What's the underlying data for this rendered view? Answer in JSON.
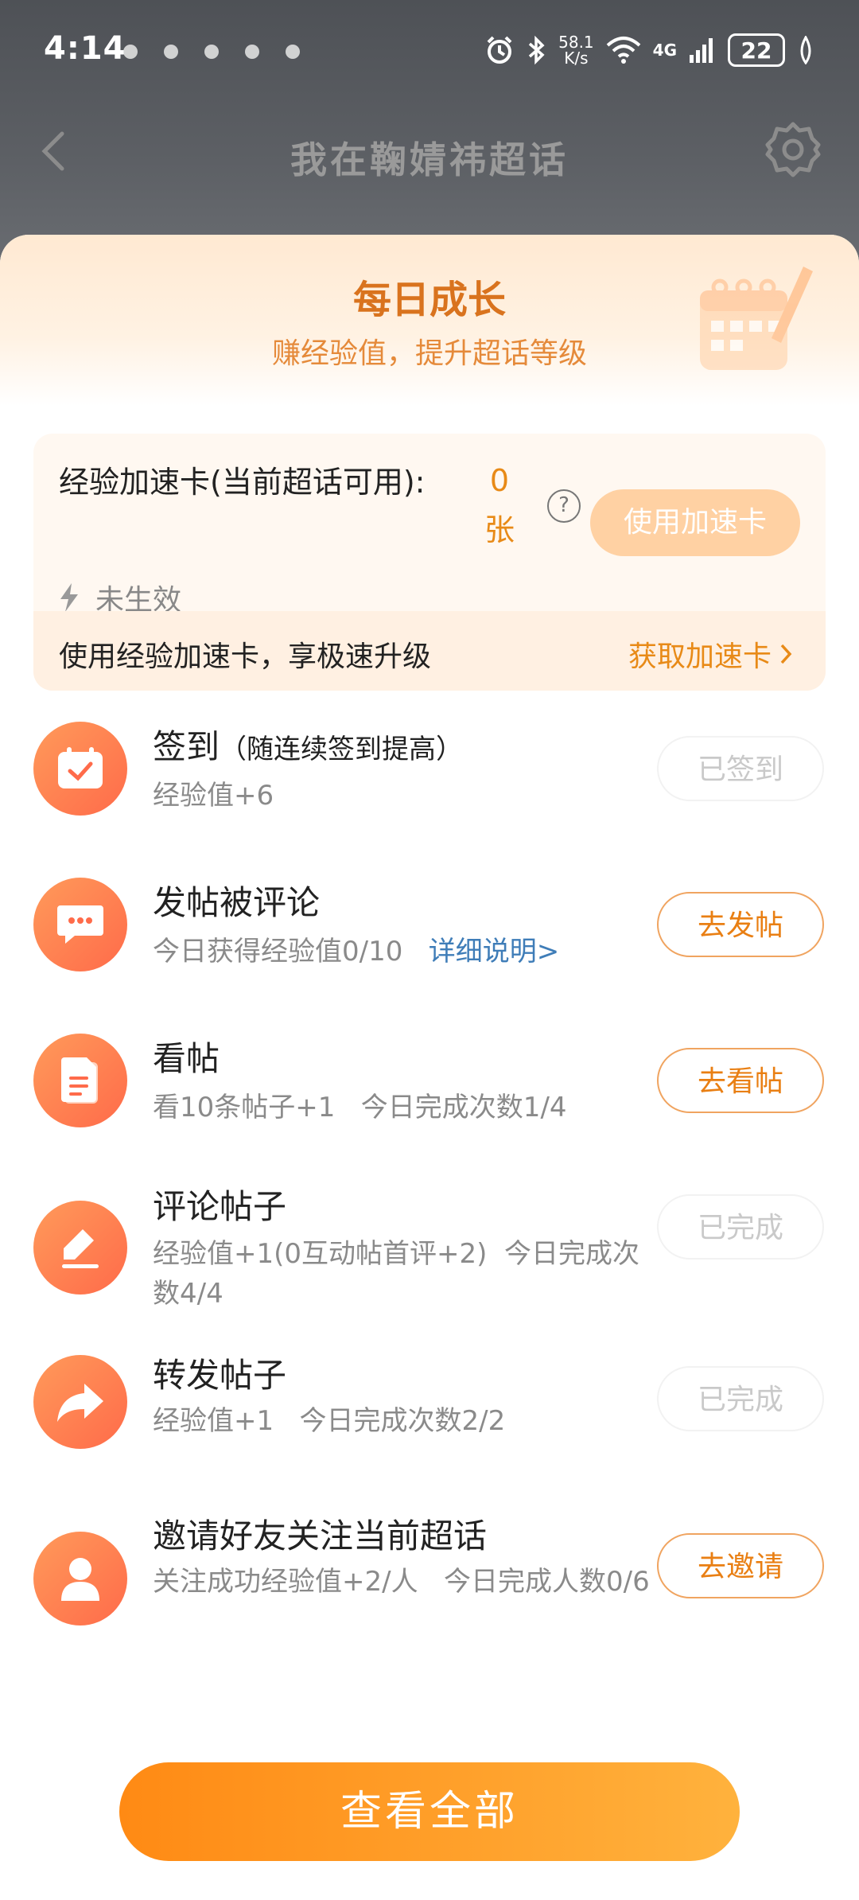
{
  "status_bar": {
    "time": "4:14",
    "network_speed_value": "58.1",
    "network_speed_unit": "K/s",
    "network_type": "4G",
    "battery": "22"
  },
  "navbar": {
    "title": "我在鞠婧祎超话"
  },
  "banner": {
    "title": "每日成长",
    "subtitle": "赚经验值，提升超话等级"
  },
  "accel_card": {
    "label": "经验加速卡(当前超话可用):",
    "count_value": "0",
    "count_unit": "张",
    "help": "?",
    "use_button": "使用加速卡",
    "status": "未生效",
    "footer_desc": "使用经验加速卡，享极速升级",
    "get_link": "获取加速卡"
  },
  "tasks": [
    {
      "title": "签到",
      "hint": "（随连续签到提高）",
      "desc": "经验值+6",
      "button": "已签到"
    },
    {
      "title": "发帖被评论",
      "desc": "今日获得经验值0/10",
      "link": "详细说明>",
      "button": "去发帖"
    },
    {
      "title": "看帖",
      "desc": "看10条帖子+1   今日完成次数1/4",
      "button": "去看帖"
    },
    {
      "title": "评论帖子",
      "desc": "经验值+1(0互动帖首评+2)  今日完成次数4/4",
      "button": "已完成"
    },
    {
      "title": "转发帖子",
      "desc": "经验值+1   今日完成次数2/2",
      "button": "已完成"
    },
    {
      "title": "邀请好友关注当前超话",
      "desc": "关注成功经验值+2/人   今日完成人数0/6",
      "button": "去邀请"
    }
  ],
  "view_all_button": "查看全部",
  "colors": {
    "accent": "#e88a17",
    "icon_gradient_start": "#ff9a5a",
    "icon_gradient_end": "#ff6b4a",
    "link": "#3f7db8"
  }
}
